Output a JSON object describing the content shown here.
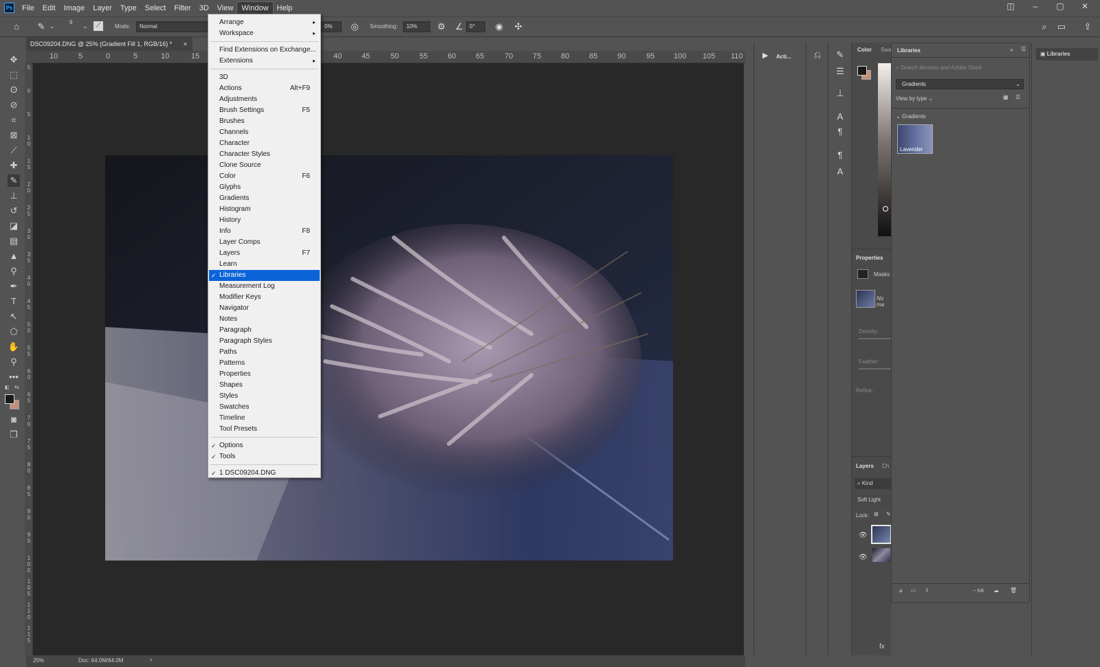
{
  "app": {
    "logo": "Ps"
  },
  "menubar": {
    "items": [
      "File",
      "Edit",
      "Image",
      "Layer",
      "Type",
      "Select",
      "Filter",
      "3D",
      "View",
      "Window",
      "Help"
    ],
    "active": "Window"
  },
  "optionsbar": {
    "brush_size": "9",
    "mode_label": "Mode:",
    "mode_value": "Normal",
    "opacity_value": "0%",
    "smoothing_label": "Smoothing:",
    "smoothing_value": "10%",
    "angle_value": "0°"
  },
  "document": {
    "tab_title": "DSC09204.DNG @ 25% (Gradient Fill 1, RGB/16) *",
    "close": "×",
    "ruler_top": [
      "10",
      "5",
      "0",
      "5",
      "10",
      "15",
      "40",
      "45",
      "50",
      "55",
      "60",
      "65",
      "70",
      "75",
      "80",
      "85",
      "90",
      "95",
      "100",
      "105",
      "110"
    ],
    "ruler_left": [
      "5",
      "0",
      "5",
      "1\n0",
      "1\n5",
      "2\n0",
      "2\n5",
      "3\n0",
      "3\n5",
      "4\n0",
      "4\n5",
      "5\n0",
      "5\n5",
      "6\n0",
      "6\n5",
      "7\n0",
      "7\n5",
      "8\n0",
      "8\n5",
      "9\n0",
      "9\n5",
      "1\n0\n0",
      "1\n0\n5",
      "1\n1\n0",
      "1\n1\n5"
    ],
    "zoom": "25%",
    "doc_size": "Doc: 64.0M/64.0M",
    "status_arrow": "›"
  },
  "window_menu": {
    "items": [
      {
        "label": "Arrange",
        "submenu": true
      },
      {
        "label": "Workspace",
        "submenu": true
      },
      {
        "label": "Find Extensions on Exchange..."
      },
      {
        "label": "Extensions",
        "submenu": true
      },
      {
        "label": "3D"
      },
      {
        "label": "Actions",
        "shortcut": "Alt+F9"
      },
      {
        "label": "Adjustments"
      },
      {
        "label": "Brush Settings",
        "shortcut": "F5"
      },
      {
        "label": "Brushes"
      },
      {
        "label": "Channels"
      },
      {
        "label": "Character"
      },
      {
        "label": "Character Styles"
      },
      {
        "label": "Clone Source"
      },
      {
        "label": "Color",
        "shortcut": "F6"
      },
      {
        "label": "Glyphs"
      },
      {
        "label": "Gradients"
      },
      {
        "label": "Histogram"
      },
      {
        "label": "History"
      },
      {
        "label": "Info",
        "shortcut": "F8"
      },
      {
        "label": "Layer Comps"
      },
      {
        "label": "Layers",
        "shortcut": "F7"
      },
      {
        "label": "Learn"
      },
      {
        "label": "Libraries",
        "checked": true,
        "highlighted": true
      },
      {
        "label": "Measurement Log"
      },
      {
        "label": "Modifier Keys"
      },
      {
        "label": "Navigator"
      },
      {
        "label": "Notes"
      },
      {
        "label": "Paragraph"
      },
      {
        "label": "Paragraph Styles"
      },
      {
        "label": "Paths"
      },
      {
        "label": "Patterns"
      },
      {
        "label": "Properties"
      },
      {
        "label": "Shapes"
      },
      {
        "label": "Styles"
      },
      {
        "label": "Swatches"
      },
      {
        "label": "Timeline"
      },
      {
        "label": "Tool Presets"
      },
      {
        "label": "Options",
        "checked": true
      },
      {
        "label": "Tools",
        "checked": true
      },
      {
        "label": "1 DSC09204.DNG",
        "checked": true
      }
    ],
    "check_mark": "✓",
    "submenu_arrow": "▸"
  },
  "panels": {
    "actions_tab": "Acti...",
    "color_tab": "Color",
    "swatches_tab": "Swa",
    "properties_tab": "Properties",
    "masks_label": "Masks",
    "no_mask": "No ma",
    "density_label": "Density:",
    "feather_label": "Feather:",
    "refine_label": "Refine:",
    "layers_tab": "Layers",
    "channels_tab": "Ch",
    "kind_label": "Kind",
    "blend_mode": "Soft Light",
    "lock_label": "Lock:",
    "libraries_collapsed": "Libraries"
  },
  "libraries": {
    "title": "Libraries",
    "search_placeholder": "Search libraries and Adobe Stock",
    "selected_library": "Gradients",
    "view_by": "View by type",
    "section": "Gradients",
    "item_name": "Lavender",
    "size_label": "-- KB"
  },
  "colors": {
    "accent": "#0a64d8",
    "ui_bg": "#535353",
    "canvas_bg": "#282828",
    "fg_swatch": "#1a1a1a",
    "bg_swatch": "#c58f78"
  }
}
